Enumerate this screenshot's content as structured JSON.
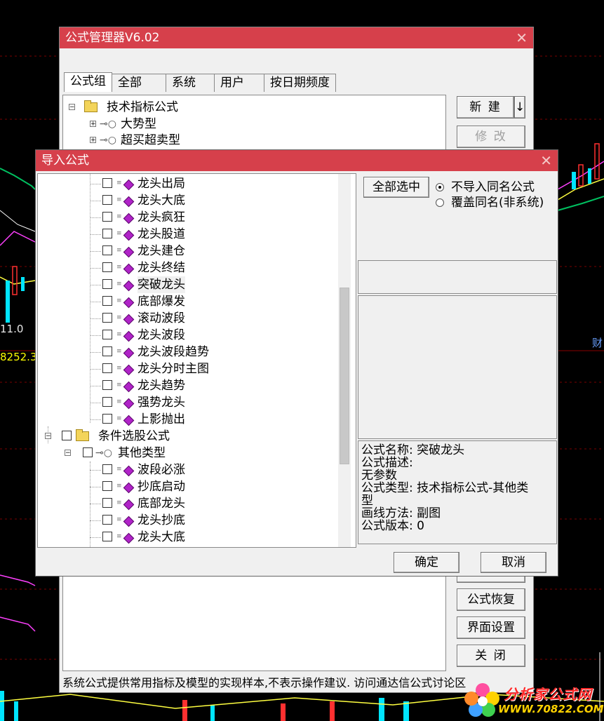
{
  "background": {
    "axis_labels": [
      "11.0",
      "8252.3",
      "财"
    ]
  },
  "manager": {
    "title": "公式管理器V6.02",
    "tabs": [
      "公式组",
      "全部",
      "系统",
      "用户",
      "按日期频度"
    ],
    "tree": [
      {
        "label": "技术指标公式",
        "expander": "−"
      },
      {
        "label": "大势型",
        "expander": "+"
      },
      {
        "label": "超买超卖型",
        "expander": "+"
      }
    ],
    "buttons": {
      "new": "新 建",
      "new_arrow": "↓",
      "edit": "修 改",
      "restore": "公式恢复",
      "ui_settings": "界面设置",
      "close": "关 闭"
    },
    "status_text": "系统公式提供常用指标及模型的实现样本,不表示操作建议. 访问通达信公式讨论区"
  },
  "import_dialog": {
    "title": "导入公式",
    "select_all": "全部选中",
    "radio_options": [
      {
        "label": "不导入同名公式",
        "checked": true
      },
      {
        "label": "覆盖同名(非系统)",
        "checked": false
      }
    ],
    "tree_items_group1": [
      "龙头出局",
      "龙头大底",
      "龙头疯狂",
      "龙头股道",
      "龙头建仓",
      "龙头终结",
      "突破龙头",
      "底部爆发",
      "滚动波段",
      "龙头波段",
      "龙头波段趋势",
      "龙头分时主图",
      "龙头趋势",
      "强势龙头",
      "上影抛出"
    ],
    "selected_item": "突破龙头",
    "folder_label": "条件选股公式",
    "subfolder_label": "其他类型",
    "tree_items_group2": [
      "波段必涨",
      "抄底启动",
      "底部龙头",
      "龙头抄底",
      "龙头大底"
    ],
    "info": [
      "公式名称: 突破龙头",
      "公式描述:",
      "无参数",
      "公式类型: 技术指标公式-其他类",
      "型",
      "画线方法: 副图",
      "公式版本: 0"
    ],
    "ok": "确定",
    "cancel": "取消"
  },
  "watermark": {
    "line1": "分析家公式网",
    "line2": "WWW.70822.COM"
  }
}
